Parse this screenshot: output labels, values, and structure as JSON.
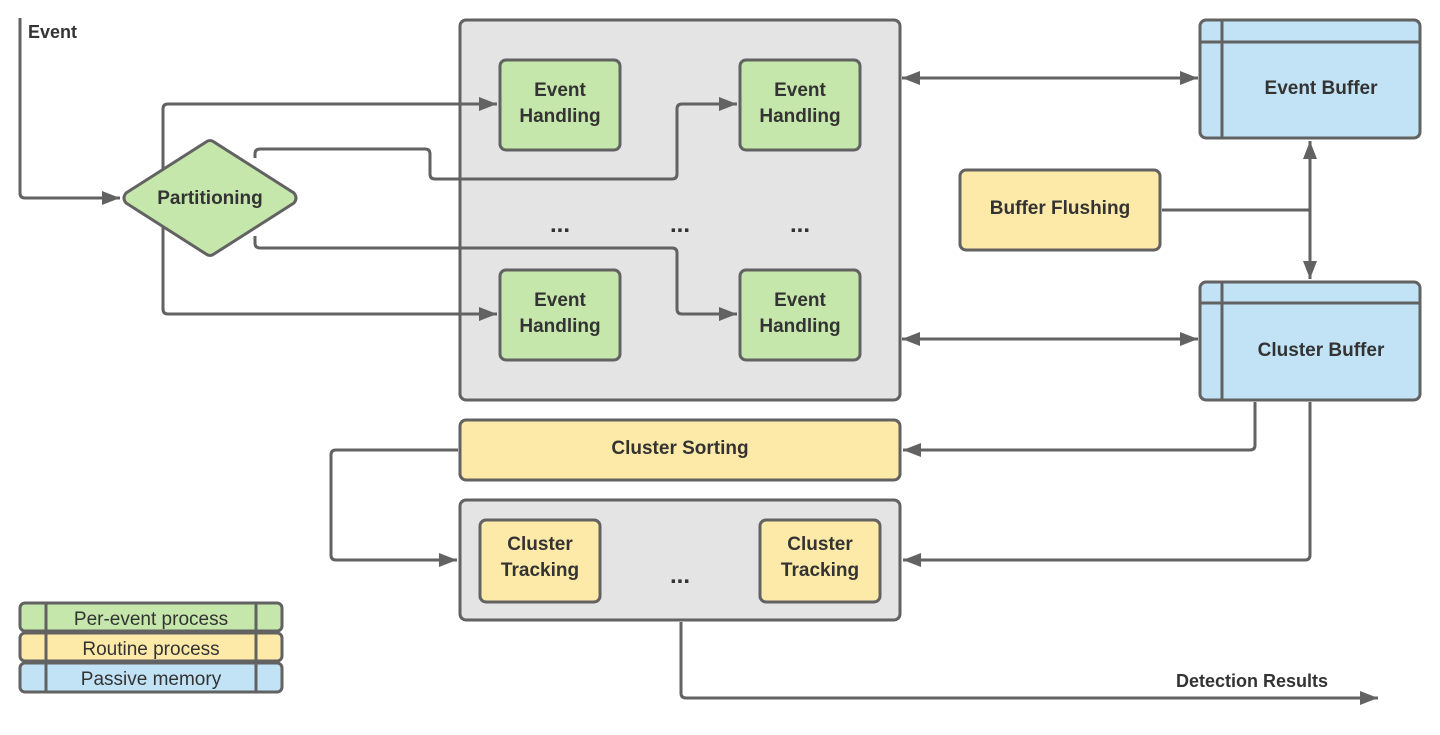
{
  "colors": {
    "per_event": "#c6e7ab",
    "routine": "#fdeaa8",
    "memory": "#c2e3f6",
    "group": "#e4e4e4",
    "stroke": "#626262",
    "text": "#333333"
  },
  "labels": {
    "event_input": "Event",
    "partitioning": "Partitioning",
    "event_handling": [
      [
        "Event",
        "Handling"
      ],
      [
        "Event",
        "Handling"
      ],
      [
        "Event",
        "Handling"
      ],
      [
        "Event",
        "Handling"
      ]
    ],
    "ellipsis": "...",
    "event_buffer": "Event Buffer",
    "buffer_flushing": "Buffer Flushing",
    "cluster_buffer": "Cluster Buffer",
    "cluster_sorting": "Cluster Sorting",
    "cluster_tracking": [
      [
        "Cluster",
        "Tracking"
      ],
      [
        "Cluster",
        "Tracking"
      ]
    ],
    "detection_results": "Detection Results"
  },
  "legend": [
    {
      "label": "Per-event process",
      "kind": "per_event"
    },
    {
      "label": "Routine process",
      "kind": "routine"
    },
    {
      "label": "Passive memory",
      "kind": "memory"
    }
  ]
}
